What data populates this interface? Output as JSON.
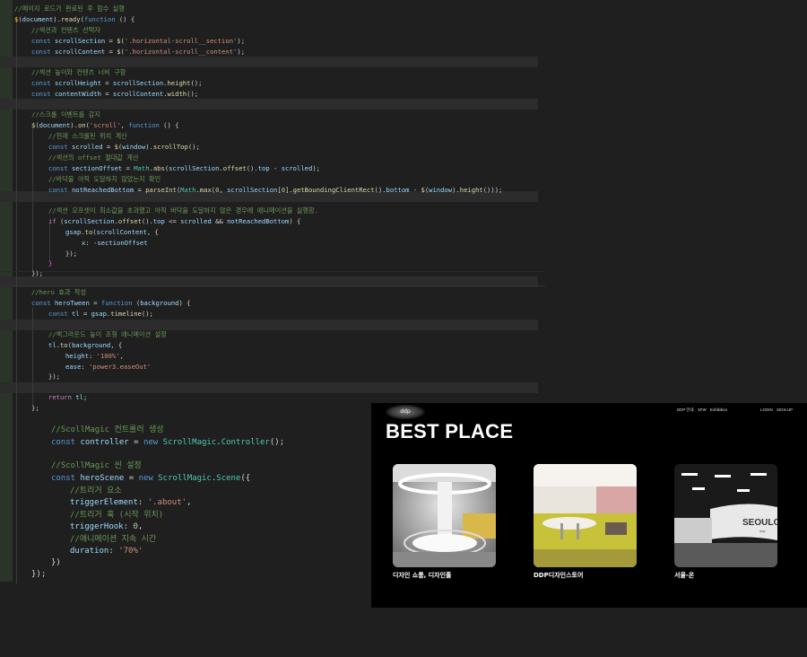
{
  "editor": {
    "lines": [
      {
        "tokens": [
          [
            "c",
            "//페이지 로드가 완료된 후 함수 실행"
          ]
        ]
      },
      {
        "tokens": [
          [
            "b1",
            "$"
          ],
          [
            "p",
            "("
          ],
          [
            "v",
            "document"
          ],
          [
            "p",
            ")."
          ],
          [
            "f",
            "ready"
          ],
          [
            "p",
            "("
          ],
          [
            "kw",
            "function"
          ],
          [
            "p",
            " () {"
          ]
        ]
      },
      {
        "tokens": [
          [
            "c",
            "//섹션과 컨텐츠 선택자"
          ]
        ]
      },
      {
        "tokens": [
          [
            "kw",
            "const "
          ],
          [
            "v",
            "scrollSection"
          ],
          [
            "p",
            " = "
          ],
          [
            "f",
            "$"
          ],
          [
            "p",
            "("
          ],
          [
            "s",
            "'.horizontal-scroll__section'"
          ],
          [
            "p",
            ");"
          ]
        ]
      },
      {
        "tokens": [
          [
            "kw",
            "const "
          ],
          [
            "v",
            "scrollContent"
          ],
          [
            "p",
            " = "
          ],
          [
            "f",
            "$"
          ],
          [
            "p",
            "("
          ],
          [
            "s",
            "'.horizontal-scroll__content'"
          ],
          [
            "p",
            ");"
          ]
        ]
      },
      {
        "tokens": []
      },
      {
        "tokens": [
          [
            "c",
            "//섹션 높이와 컨텐츠 너비 구함"
          ]
        ]
      },
      {
        "tokens": [
          [
            "kw",
            "const "
          ],
          [
            "v",
            "scrollHeight"
          ],
          [
            "p",
            " = "
          ],
          [
            "v",
            "scrollSection"
          ],
          [
            "p",
            "."
          ],
          [
            "f",
            "height"
          ],
          [
            "p",
            "();"
          ]
        ]
      },
      {
        "tokens": [
          [
            "kw",
            "const "
          ],
          [
            "v",
            "contentWidth"
          ],
          [
            "p",
            " = "
          ],
          [
            "v",
            "scrollContent"
          ],
          [
            "p",
            "."
          ],
          [
            "f",
            "width"
          ],
          [
            "p",
            "();"
          ]
        ]
      },
      {
        "tokens": []
      },
      {
        "tokens": [
          [
            "c",
            "//스크롤 이벤트를 감지"
          ]
        ]
      },
      {
        "tokens": [
          [
            "f",
            "$"
          ],
          [
            "p",
            "("
          ],
          [
            "v",
            "document"
          ],
          [
            "p",
            ")."
          ],
          [
            "f",
            "on"
          ],
          [
            "p",
            "("
          ],
          [
            "s",
            "'scroll'"
          ],
          [
            "p",
            ", "
          ],
          [
            "kw",
            "function"
          ],
          [
            "p",
            " () {"
          ]
        ]
      },
      {
        "tokens": [
          [
            "c",
            "//현재 스크롤된 위치 계산"
          ]
        ]
      },
      {
        "tokens": [
          [
            "kw",
            "const "
          ],
          [
            "v",
            "scrolled"
          ],
          [
            "p",
            " = "
          ],
          [
            "f",
            "$"
          ],
          [
            "p",
            "("
          ],
          [
            "v",
            "window"
          ],
          [
            "p",
            ")."
          ],
          [
            "f",
            "scrollTop"
          ],
          [
            "p",
            "();"
          ]
        ]
      },
      {
        "tokens": [
          [
            "c",
            "//섹션의 offset 절대값 계산"
          ]
        ]
      },
      {
        "tokens": [
          [
            "kw",
            "const "
          ],
          [
            "v",
            "sectionOffset"
          ],
          [
            "p",
            " = "
          ],
          [
            "cls",
            "Math"
          ],
          [
            "p",
            "."
          ],
          [
            "f",
            "abs"
          ],
          [
            "p",
            "("
          ],
          [
            "v",
            "scrollSection"
          ],
          [
            "p",
            "."
          ],
          [
            "f",
            "offset"
          ],
          [
            "p",
            "()."
          ],
          [
            "v",
            "top"
          ],
          [
            "p",
            " - "
          ],
          [
            "v",
            "scrolled"
          ],
          [
            "p",
            ");"
          ]
        ]
      },
      {
        "tokens": [
          [
            "c",
            "//바닥을 아직 도달하지 않았는지 확인"
          ]
        ]
      },
      {
        "tokens": [
          [
            "kw",
            "const "
          ],
          [
            "v",
            "notReachedBottom"
          ],
          [
            "p",
            " = "
          ],
          [
            "f",
            "parseInt"
          ],
          [
            "p",
            "("
          ],
          [
            "cls",
            "Math"
          ],
          [
            "p",
            "."
          ],
          [
            "f",
            "max"
          ],
          [
            "p",
            "("
          ],
          [
            "n",
            "0"
          ],
          [
            "p",
            ", "
          ],
          [
            "v",
            "scrollSection"
          ],
          [
            "p",
            "["
          ],
          [
            "n",
            "0"
          ],
          [
            "p",
            "]."
          ],
          [
            "f",
            "getBoundingClientRect"
          ],
          [
            "p",
            "()."
          ],
          [
            "v",
            "bottom"
          ],
          [
            "p",
            " - "
          ],
          [
            "f",
            "$"
          ],
          [
            "p",
            "("
          ],
          [
            "v",
            "window"
          ],
          [
            "p",
            ")."
          ],
          [
            "f",
            "height"
          ],
          [
            "p",
            "()));"
          ]
        ]
      },
      {
        "tokens": []
      },
      {
        "tokens": [
          [
            "c",
            "//섹션 오프셋이 최소값을 초과했고 아직 바닥을 도달하지 않은 경우에 애니메이션을 실행함."
          ]
        ]
      },
      {
        "tokens": [
          [
            "k",
            "if"
          ],
          [
            "p",
            " ("
          ],
          [
            "v",
            "scrollSection"
          ],
          [
            "p",
            "."
          ],
          [
            "f",
            "offset"
          ],
          [
            "p",
            "()."
          ],
          [
            "v",
            "top"
          ],
          [
            "p",
            " <= "
          ],
          [
            "v",
            "scrolled"
          ],
          [
            "p",
            " && "
          ],
          [
            "v",
            "notReachedBottom"
          ],
          [
            "p",
            ") {"
          ]
        ]
      },
      {
        "tokens": [
          [
            "v",
            "gsap"
          ],
          [
            "p",
            "."
          ],
          [
            "f",
            "to"
          ],
          [
            "p",
            "("
          ],
          [
            "v",
            "scrollContent"
          ],
          [
            "p",
            ", {"
          ]
        ]
      },
      {
        "tokens": [
          [
            "v",
            "x"
          ],
          [
            "p",
            ": -"
          ],
          [
            "v",
            "sectionOffset"
          ]
        ]
      },
      {
        "tokens": [
          [
            "p",
            "});"
          ]
        ]
      },
      {
        "tokens": [
          [
            "b2",
            "}"
          ]
        ]
      },
      {
        "tokens": [
          [
            "p",
            "});"
          ]
        ]
      },
      {
        "tokens": []
      },
      {
        "tokens": [
          [
            "c",
            "//hero 효과 작성"
          ]
        ]
      },
      {
        "tokens": [
          [
            "kw",
            "const "
          ],
          [
            "v",
            "heroTween"
          ],
          [
            "p",
            " = "
          ],
          [
            "kw",
            "function"
          ],
          [
            "p",
            " ("
          ],
          [
            "v",
            "background"
          ],
          [
            "p",
            ") {"
          ]
        ]
      },
      {
        "tokens": [
          [
            "kw",
            "const "
          ],
          [
            "v",
            "tl"
          ],
          [
            "p",
            " = "
          ],
          [
            "v",
            "gsap"
          ],
          [
            "p",
            "."
          ],
          [
            "f",
            "timeline"
          ],
          [
            "p",
            "();"
          ]
        ]
      },
      {
        "tokens": []
      },
      {
        "tokens": [
          [
            "c",
            "//백그라운드 높이 조형 애니메이션 설정"
          ]
        ]
      },
      {
        "tokens": [
          [
            "v",
            "tl"
          ],
          [
            "p",
            "."
          ],
          [
            "f",
            "to"
          ],
          [
            "p",
            "("
          ],
          [
            "v",
            "background"
          ],
          [
            "p",
            ", {"
          ]
        ]
      },
      {
        "tokens": [
          [
            "v",
            "height"
          ],
          [
            "p",
            ": "
          ],
          [
            "s",
            "'100%'"
          ],
          [
            "p",
            ","
          ]
        ]
      },
      {
        "tokens": [
          [
            "v",
            "ease"
          ],
          [
            "p",
            ": "
          ],
          [
            "s",
            "'power3.easeOut'"
          ]
        ]
      },
      {
        "tokens": [
          [
            "p",
            "});"
          ]
        ]
      },
      {
        "tokens": []
      },
      {
        "tokens": [
          [
            "k",
            "return "
          ],
          [
            "v",
            "tl"
          ],
          [
            "p",
            ";"
          ]
        ]
      },
      {
        "tokens": [
          [
            "p",
            "};"
          ]
        ]
      }
    ],
    "lines_large": [
      {
        "tokens": [
          [
            "c",
            "//ScollMagic 컨트롤러 생성"
          ]
        ]
      },
      {
        "tokens": [
          [
            "kw",
            "const "
          ],
          [
            "v",
            "controller"
          ],
          [
            "p",
            " = "
          ],
          [
            "kw",
            "new "
          ],
          [
            "cls",
            "ScrollMagic"
          ],
          [
            "p",
            "."
          ],
          [
            "cls",
            "Controller"
          ],
          [
            "p",
            "();"
          ]
        ]
      },
      {
        "tokens": []
      },
      {
        "tokens": [
          [
            "c",
            "//ScollMagic 씬 설정"
          ]
        ]
      },
      {
        "tokens": [
          [
            "kw",
            "const "
          ],
          [
            "v",
            "heroScene"
          ],
          [
            "p",
            " = "
          ],
          [
            "kw",
            "new "
          ],
          [
            "cls",
            "ScrollMagic"
          ],
          [
            "p",
            "."
          ],
          [
            "cls",
            "Scene"
          ],
          [
            "p",
            "({"
          ]
        ]
      },
      {
        "tokens": [
          [
            "c",
            "//트리거 요소"
          ]
        ]
      },
      {
        "tokens": [
          [
            "v",
            "triggerElement"
          ],
          [
            "p",
            ": "
          ],
          [
            "s",
            "'.about'"
          ],
          [
            "p",
            ","
          ]
        ]
      },
      {
        "tokens": [
          [
            "c",
            "//트리거 훅 (시작 위치)"
          ]
        ]
      },
      {
        "tokens": [
          [
            "v",
            "triggerHook"
          ],
          [
            "p",
            ": "
          ],
          [
            "n",
            "0"
          ],
          [
            "p",
            ","
          ]
        ]
      },
      {
        "tokens": [
          [
            "c",
            "//애니메이션 지속 시간"
          ]
        ]
      },
      {
        "tokens": [
          [
            "v",
            "duration"
          ],
          [
            "p",
            ": "
          ],
          [
            "s",
            "'70%'"
          ]
        ]
      },
      {
        "tokens": [
          [
            "p",
            "})"
          ]
        ]
      },
      {
        "tokens": [
          [
            "p",
            "});"
          ]
        ]
      }
    ]
  },
  "preview": {
    "logo_text": "ddp",
    "nav_items": [
      "DDP 안내",
      "SFW",
      "Exhibition"
    ],
    "auth_items": [
      "LOGIN",
      "SIGN UP"
    ],
    "title": "BEST PLACE",
    "cards": [
      {
        "caption": "디자인 쇼룸, 디자인홀"
      },
      {
        "caption": "DDP디자인스토어"
      },
      {
        "caption": "서울-온"
      }
    ],
    "billboard_text": "SEOULON",
    "billboard_sub": "ddp"
  }
}
